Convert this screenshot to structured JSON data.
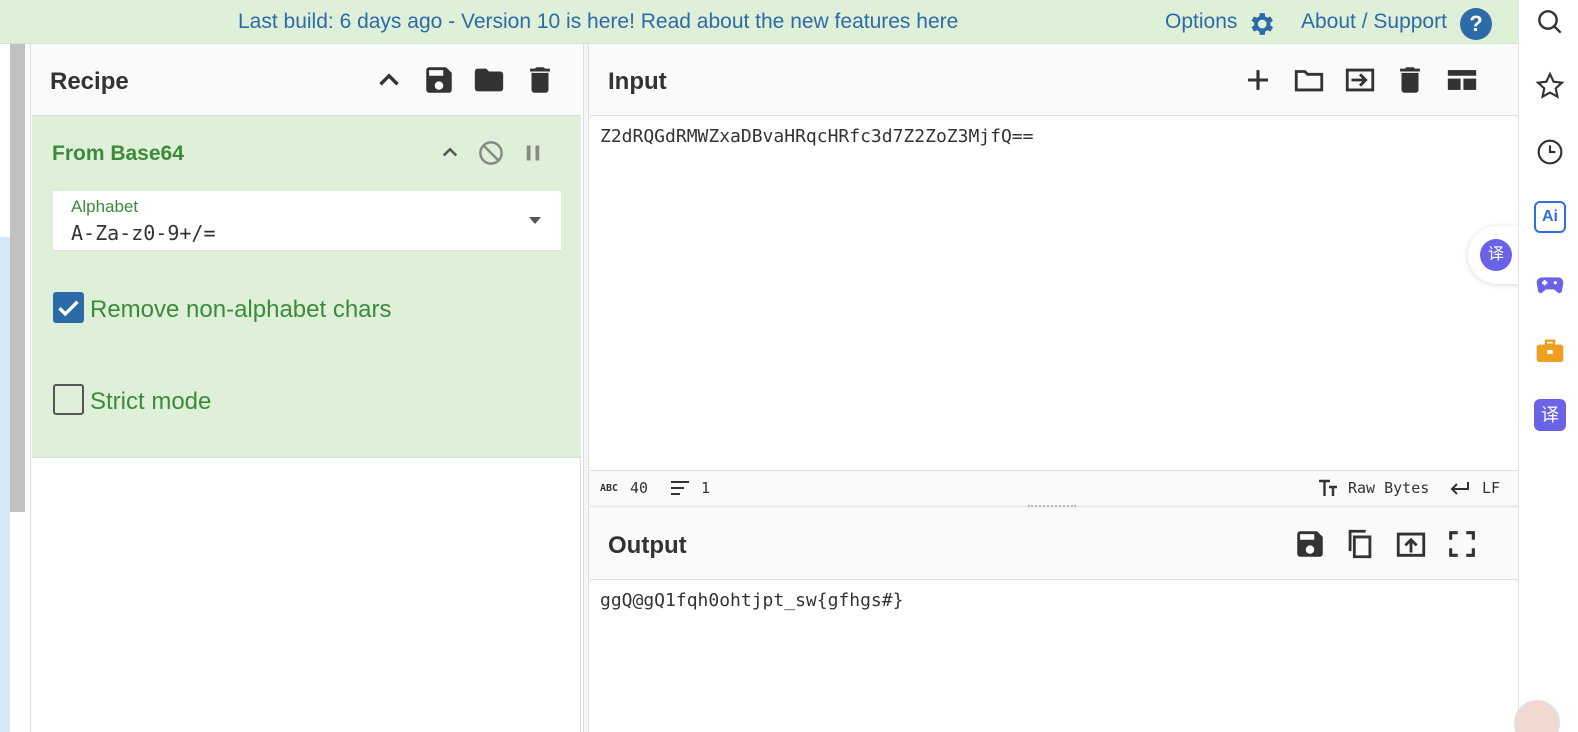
{
  "banner": {
    "build_text": "Last build: 6 days ago - Version 10 is here! Read about the new features here",
    "options_label": "Options",
    "about_label": "About / Support",
    "help_glyph": "?"
  },
  "recipe": {
    "title": "Recipe",
    "operation": {
      "name": "From Base64",
      "alphabet_label": "Alphabet",
      "alphabet_value": "A-Za-z0-9+/=",
      "remove_non_alphabet_label": "Remove non-alphabet chars",
      "remove_non_alphabet_checked": true,
      "strict_mode_label": "Strict mode",
      "strict_mode_checked": false
    }
  },
  "input": {
    "title": "Input",
    "value": "Z2dRQGdRMWZxaDBvaHRqcHRfc3d7Z2ZoZ3MjfQ==",
    "status": {
      "abc_label": "ABC",
      "length": "40",
      "lines": "1",
      "encoding": "Raw Bytes",
      "eol": "LF"
    }
  },
  "output": {
    "title": "Output",
    "value": "ggQ@gQ1fqh0ohtjpt_sw{gfhgs#}"
  },
  "sidebar": {
    "icons": [
      "search-icon",
      "star-icon",
      "history-icon",
      "ai-icon",
      "game-icon",
      "toolbox-icon",
      "translate-icon"
    ],
    "translate_glyph": "译",
    "ai_label": "Ai"
  },
  "colors": {
    "banner_bg": "#dff0d8",
    "link": "#2d6aa8",
    "op_green": "#3c8a3c",
    "checkbox_blue": "#2d6aa8",
    "translate_purple": "#6a63e8"
  }
}
